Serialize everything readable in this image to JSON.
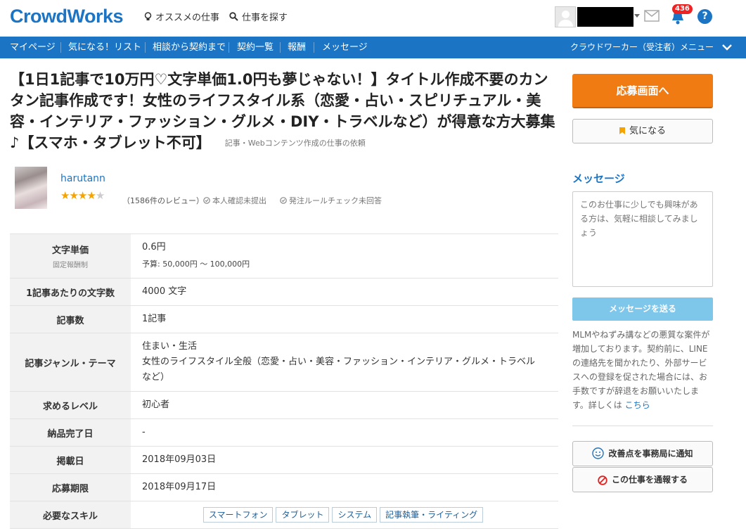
{
  "header": {
    "logo": "CrowdWorks",
    "recommend_label": "オススメの仕事",
    "search_label": "仕事を探す",
    "notification_count": "436"
  },
  "nav": {
    "items": [
      "マイページ",
      "気になる！リスト",
      "相談から契約まで",
      "契約一覧",
      "報酬",
      "メッセージ"
    ],
    "menu_right": "クラウドワーカー（受注者）メニュー"
  },
  "job": {
    "title": "【1日1記事で10万円♡文字単価1.0円も夢じゃない！】タイトル作成不要のカンタン記事作成です！女性のライフスタイル系（恋愛・占い・スピリチュアル・美容・インテリア・ファッション・グルメ・DIY・トラベルなど）が得意な方大募集♪【スマホ・タブレット不可】",
    "category": "記事・Webコンテンツ作成の仕事の依頼"
  },
  "client": {
    "name": "harutann",
    "rating": 4,
    "rating_max": 5,
    "reviews": "（1586件のレビュー）",
    "identity": "本人確認未提出",
    "rule_check": "発注ルールチェック未回答"
  },
  "details": {
    "unit_price_label": "文字単価",
    "unit_price_sub": "固定報酬制",
    "unit_price_value": "0.6円",
    "budget": "予算: 50,000円 〜 100,000円",
    "chars_label": "1記事あたりの文字数",
    "chars_value": "4000 文字",
    "count_label": "記事数",
    "count_value": "1記事",
    "genre_label": "記事ジャンル・テーマ",
    "genre_line1": "住まい・生活",
    "genre_line2": "女性のライフスタイル全般（恋愛・占い・美容・ファッション・インテリア・グルメ・トラベル　など）",
    "level_label": "求めるレベル",
    "level_value": "初心者",
    "delivery_label": "納品完了日",
    "delivery_value": "-",
    "posted_label": "掲載日",
    "posted_value": "2018年09月03日",
    "deadline_label": "応募期限",
    "deadline_value": "2018年09月17日",
    "skills_label": "必要なスキル",
    "skills": [
      "スマートフォン",
      "タブレット",
      "システム",
      "記事執筆・ライティング"
    ]
  },
  "sidebar": {
    "apply_label": "応募画面へ",
    "favorite_label": "気になる",
    "message_heading": "メッセージ",
    "message_placeholder": "このお仕事に少しでも興味がある方は、気軽に相談してみましょう",
    "send_label": "メッセージを送る",
    "notice_text": "MLMやねずみ講などの悪質な案件が増加しております。契約前に、LINEの連絡先を聞かれたり、外部サービスへの登録を促された場合には、お手数ですが辞退をお願いいたします。詳しくは",
    "notice_link": "こちら",
    "improve_label": "改善点を事務局に通知",
    "report_label": "この仕事を通報する"
  },
  "colors": {
    "brand": "#1b74c4",
    "apply": "#ef7b12",
    "send": "#7ec6ea",
    "star": "#f5a300",
    "badge": "#e22222"
  }
}
